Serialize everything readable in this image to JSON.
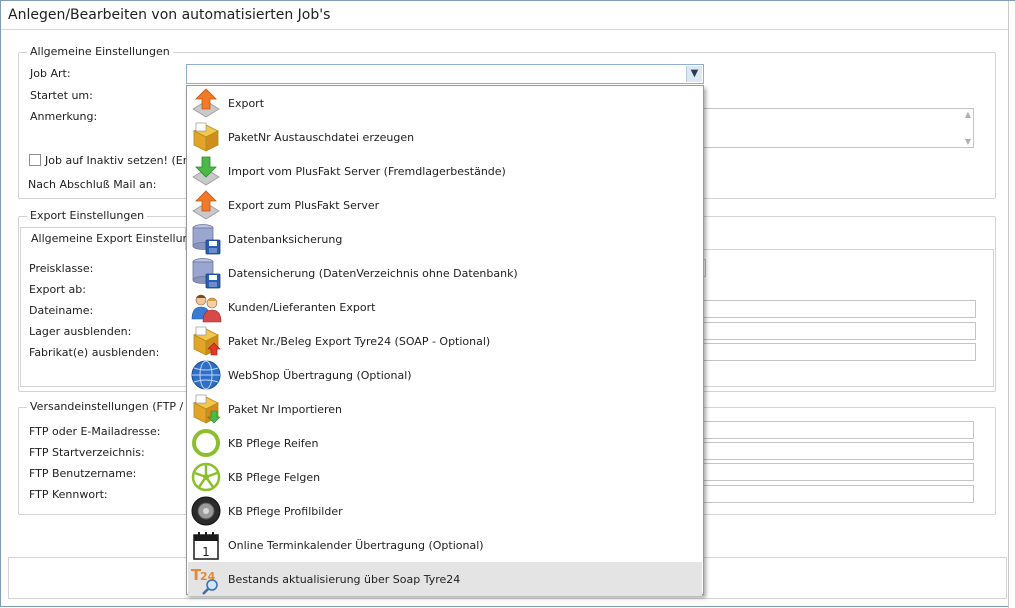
{
  "window": {
    "title": "Anlegen/Bearbeiten von automatisierten Job's"
  },
  "general": {
    "legend": "Allgemeine Einstellungen",
    "job_art_label": "Job Art:",
    "startet_label": "Startet um:",
    "anmerkung_label": "Anmerkung:",
    "inaktiv_label": "Job auf Inaktiv setzen! (Er wi",
    "mail_label": "Nach Abschluß Mail an:"
  },
  "export": {
    "legend": "Export Einstellungen",
    "tab_label": "Allgemeine Export Einstellungen",
    "preisklasse_label": "Preisklasse:",
    "export_ab_label": "Export ab:",
    "dateiname_label": "Dateiname:",
    "lager_label": "Lager ausblenden:",
    "fabrikat_label": "Fabrikat(e) ausblenden:"
  },
  "shipping": {
    "legend": "Versandeinstellungen (FTP / E-Ma",
    "ftp_label": "FTP oder E-Mailadresse:",
    "start_dir_label": "FTP Startverzeichnis:",
    "user_label": "FTP Benutzername:",
    "password_label": "FTP Kennwort:"
  },
  "dropdown": {
    "items": [
      {
        "label": "Export",
        "icon": "export-arrow-icon"
      },
      {
        "label": "PaketNr Austauschdatei erzeugen",
        "icon": "package-icon"
      },
      {
        "label": "Import vom PlusFakt Server (Fremdlagerbestände)",
        "icon": "import-arrow-icon"
      },
      {
        "label": "Export zum PlusFakt Server",
        "icon": "export-arrow-icon"
      },
      {
        "label": "Datenbanksicherung",
        "icon": "database-save-icon"
      },
      {
        "label": "Datensicherung (DatenVerzeichnis ohne Datenbank)",
        "icon": "database-save-icon"
      },
      {
        "label": "Kunden/Lieferanten Export",
        "icon": "users-icon"
      },
      {
        "label": "Paket Nr./Beleg Export Tyre24 (SOAP - Optional)",
        "icon": "package-export-icon"
      },
      {
        "label": "WebShop Übertragung (Optional)",
        "icon": "globe-icon"
      },
      {
        "label": "Paket Nr Importieren",
        "icon": "package-import-icon"
      },
      {
        "label": "KB Pflege Reifen",
        "icon": "tire-ring-icon"
      },
      {
        "label": "KB Pflege Felgen",
        "icon": "rim-icon"
      },
      {
        "label": "KB Pflege Profilbilder",
        "icon": "tire-profile-icon"
      },
      {
        "label": "Online Terminkalender Übertragung (Optional)",
        "icon": "calendar-icon"
      },
      {
        "label": "Bestands aktualisierung über Soap Tyre24",
        "icon": "t24-search-icon"
      }
    ],
    "selected_index": 14
  },
  "colors": {
    "accent": "#8faed6",
    "selection": "#e4e4e4",
    "border": "#d3d3d3"
  }
}
